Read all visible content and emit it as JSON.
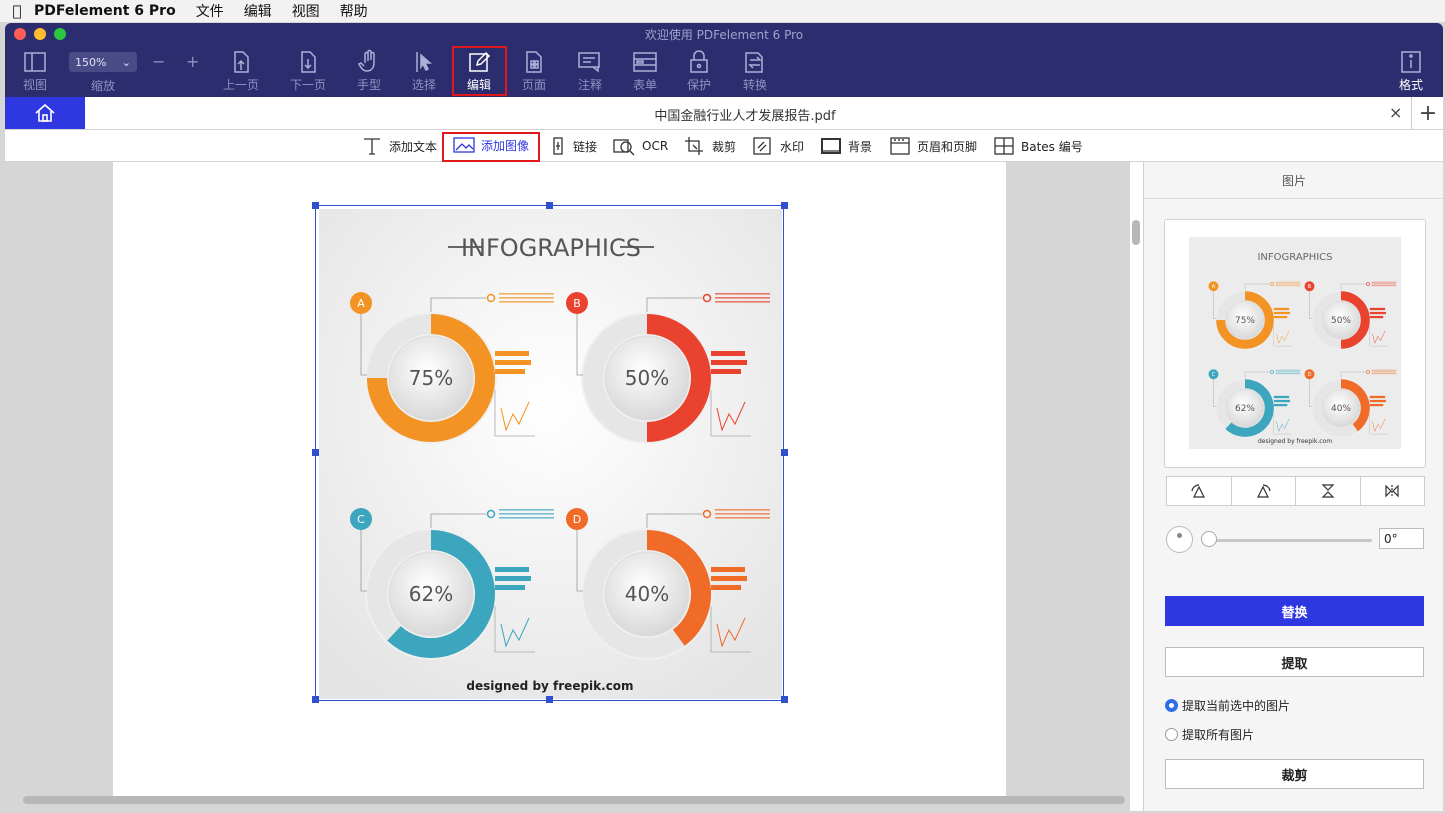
{
  "menubar": {
    "app_name": "PDFelement 6 Pro",
    "items": [
      "文件",
      "编辑",
      "视图",
      "帮助"
    ]
  },
  "window": {
    "title": "欢迎使用 PDFelement 6 Pro"
  },
  "toolbar": {
    "view": "视图",
    "zoom_value": "150%",
    "zoom_label": "缩放",
    "minus": "−",
    "plus": "+",
    "prev_page": "上一页",
    "next_page": "下一页",
    "hand": "手型",
    "select": "选择",
    "edit": "编辑",
    "page": "页面",
    "comment": "注释",
    "form": "表单",
    "protect": "保护",
    "convert": "转换",
    "format": "格式"
  },
  "tabs": {
    "filename": "中国金融行业人才发展报告.pdf",
    "close": "×",
    "add": "+"
  },
  "edit_toolbar": {
    "add_text": "添加文本",
    "add_image": "添加图像",
    "link": "链接",
    "ocr": "OCR",
    "crop": "裁剪",
    "watermark": "水印",
    "background": "背景",
    "header_footer": "页眉和页脚",
    "bates": "Bates 编号"
  },
  "infographic": {
    "title": "INFOGRAPHICS",
    "footer": "designed by freepik.com",
    "items": [
      {
        "letter": "A",
        "percent": "75%",
        "value": 0.75,
        "color": "#f39323"
      },
      {
        "letter": "B",
        "percent": "50%",
        "value": 0.5,
        "color": "#e9432f"
      },
      {
        "letter": "C",
        "percent": "62%",
        "value": 0.62,
        "color": "#3ba6bd"
      },
      {
        "letter": "D",
        "percent": "40%",
        "value": 0.4,
        "color": "#f06a28"
      }
    ]
  },
  "panel": {
    "title": "图片",
    "rotation": "0°",
    "replace": "替换",
    "extract": "提取",
    "radio_current": "提取当前选中的图片",
    "radio_all": "提取所有图片",
    "crop": "裁剪"
  }
}
